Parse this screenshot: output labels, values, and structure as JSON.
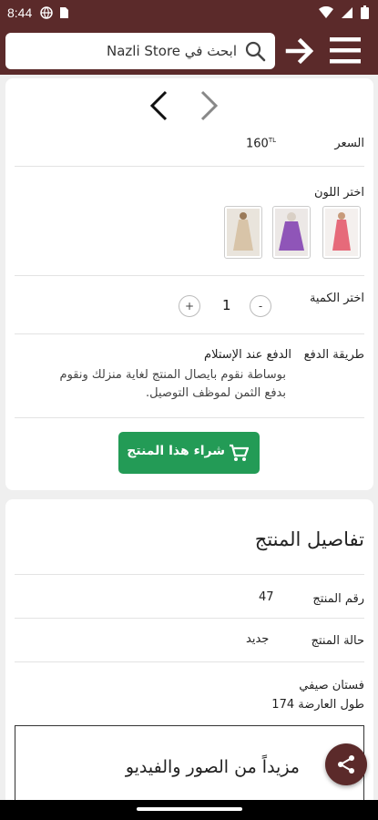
{
  "status_bar": {
    "time": "8:44"
  },
  "header": {
    "search_placeholder": "ابحث في Nazli Store"
  },
  "product": {
    "price_label": "السعر",
    "price_value": "160",
    "price_currency": "TL",
    "color_label": "اختر اللون",
    "colors": [
      "pink-dress",
      "purple-dress",
      "beige-dress"
    ],
    "quantity_label": "اختر الكمية",
    "quantity_value": "1",
    "minus": "-",
    "plus": "+",
    "payment_label": "طريقة الدفع",
    "payment_method": "الدفع عند الإستلام",
    "payment_desc": "بوساطة نقوم بايصال المنتج لغاية منزلك ونقوم بدفع الثمن لموظف التوصيل.",
    "buy_button": "شراء هذا المنتج"
  },
  "details": {
    "title": "تفاصيل المنتج",
    "rows": [
      {
        "label": "رقم المنتج",
        "value": "47"
      },
      {
        "label": "حالة المنتج",
        "value": "جديد"
      }
    ],
    "desc_line1": "فستان صيفي",
    "desc_line2": "طول العارضة 174",
    "more_media": "مزيداً من الصور والفيديو"
  },
  "colors": {
    "brand": "#5b2a2a",
    "buy": "#239b56",
    "page_bg": "#efefef"
  }
}
